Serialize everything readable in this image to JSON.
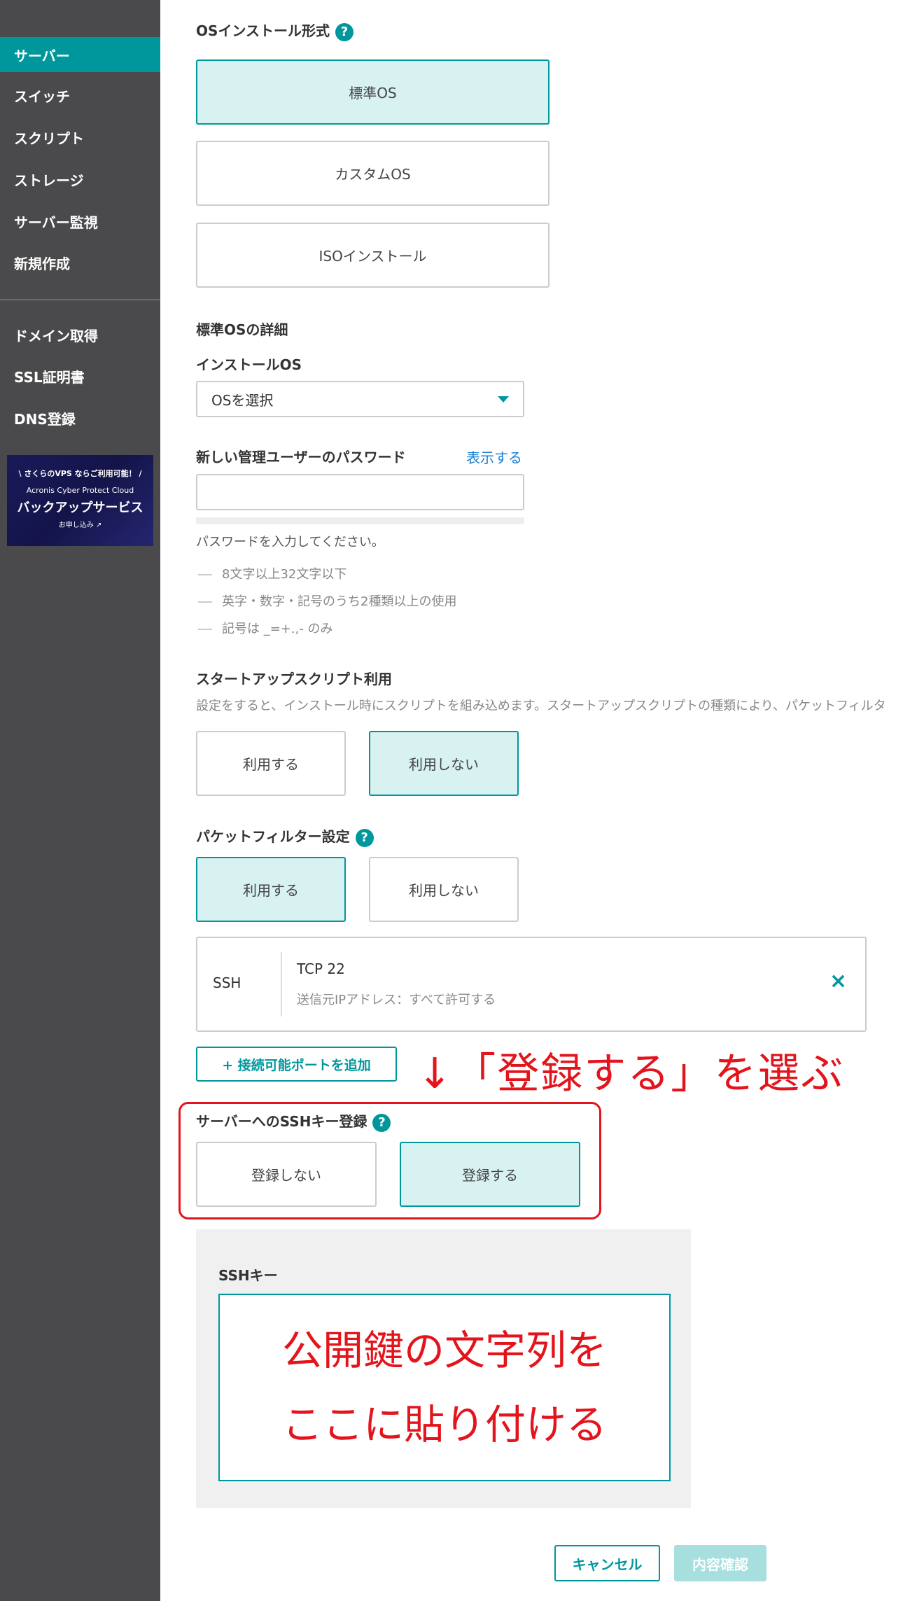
{
  "sidebar": {
    "items": [
      {
        "label": "サーバー",
        "active": true
      },
      {
        "label": "スイッチ"
      },
      {
        "label": "スクリプト"
      },
      {
        "label": "ストレージ"
      },
      {
        "label": "サーバー監視"
      },
      {
        "label": "新規作成"
      }
    ],
    "items2": [
      {
        "label": "ドメイン取得"
      },
      {
        "label": "SSL証明書"
      },
      {
        "label": "DNS登録"
      }
    ],
    "banner": {
      "line1": "\\ さくらのVPS ならご利用可能！ /",
      "line2": "Acronis Cyber Protect Cloud",
      "line3": "バックアップサービス",
      "line4": "お申し込み ↗"
    }
  },
  "os_install": {
    "heading": "OSインストール形式",
    "help": "?",
    "options": [
      "標準OS",
      "カスタムOS",
      "ISOインストール"
    ],
    "selected": "標準OS"
  },
  "standard_os": {
    "heading": "標準OSの詳細",
    "install_os_label": "インストールOS",
    "select_value": "OSを選択"
  },
  "password": {
    "label": "新しい管理ユーザーのパスワード",
    "show_link": "表示する",
    "value": "",
    "prompt": "パスワードを入力してください。",
    "rules": [
      "8文字以上32文字以下",
      "英字・数字・記号のうち2種類以上の使用",
      "記号は _=+.,- のみ"
    ]
  },
  "startup_script": {
    "heading": "スタートアップスクリプト利用",
    "description": "設定をすると、インストール時にスクリプトを組み込めます。スタートアップスクリプトの種類により、パケットフィルタ",
    "options": [
      "利用する",
      "利用しない"
    ],
    "selected": "利用しない"
  },
  "packet_filter": {
    "heading": "パケットフィルター設定",
    "help": "?",
    "options": [
      "利用する",
      "利用しない"
    ],
    "selected": "利用する",
    "rule": {
      "name": "SSH",
      "protocol": "TCP  22",
      "source": "送信元IPアドレス：すべて許可する",
      "remove": "×"
    },
    "add_port": "+ 接続可能ポートを追加"
  },
  "annotation": {
    "arrow_text": "↓「登録する」を選ぶ",
    "color": "#e3141c"
  },
  "ssh_key_register": {
    "heading": "サーバーへのSSHキー登録",
    "help": "?",
    "options": [
      "登録しない",
      "登録する"
    ],
    "selected": "登録する"
  },
  "ssh_key": {
    "label": "SSHキー",
    "overlay_line1": "公開鍵の文字列を",
    "overlay_line2": "ここに貼り付ける"
  },
  "footer": {
    "cancel": "キャンセル",
    "confirm": "内容確認"
  },
  "colors": {
    "accent": "#00979c",
    "sidebar": "#4a4a4c",
    "selected_bg": "#d8f1f1"
  }
}
